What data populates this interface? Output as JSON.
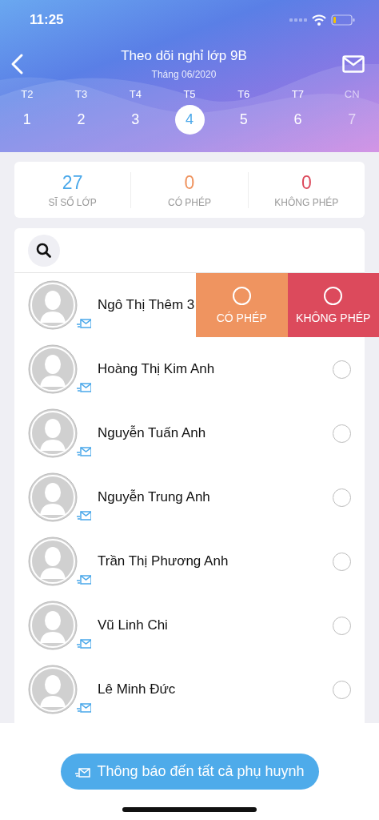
{
  "status_bar": {
    "time": "11:25"
  },
  "header": {
    "title": "Theo dõi nghỉ lớp 9B",
    "subtitle": "Tháng 06/2020"
  },
  "days": [
    {
      "weekday": "T2",
      "date": "1",
      "selected": false,
      "disabled": false
    },
    {
      "weekday": "T3",
      "date": "2",
      "selected": false,
      "disabled": false
    },
    {
      "weekday": "T4",
      "date": "3",
      "selected": false,
      "disabled": false
    },
    {
      "weekday": "T5",
      "date": "4",
      "selected": true,
      "disabled": false
    },
    {
      "weekday": "T6",
      "date": "5",
      "selected": false,
      "disabled": false
    },
    {
      "weekday": "T7",
      "date": "6",
      "selected": false,
      "disabled": false
    },
    {
      "weekday": "CN",
      "date": "7",
      "selected": false,
      "disabled": true
    }
  ],
  "stats": [
    {
      "value": "27",
      "label": "SĨ SỐ LỚP",
      "color": "#4aa8ea"
    },
    {
      "value": "0",
      "label": "CÓ PHÉP",
      "color": "#ef9460"
    },
    {
      "value": "0",
      "label": "KHÔNG PHÉP",
      "color": "#dc4a5c"
    }
  ],
  "students": [
    {
      "name": "Ngô Thị Thêm 3",
      "swiped": true,
      "actions": [
        {
          "kind": "excused",
          "label": "CÓ PHÉP"
        },
        {
          "kind": "unexcused",
          "label": "KHÔNG PHÉP"
        }
      ]
    },
    {
      "name": "Hoàng Thị Kim Anh",
      "swiped": false,
      "checked": false
    },
    {
      "name": "Nguyễn Tuấn Anh",
      "swiped": false,
      "checked": false
    },
    {
      "name": "Nguyễn Trung Anh",
      "swiped": false,
      "checked": false
    },
    {
      "name": "Trần Thị Phương Anh",
      "swiped": false,
      "checked": false
    },
    {
      "name": "Vũ Linh Chi",
      "swiped": false,
      "checked": false
    },
    {
      "name": "Lê Minh Đức",
      "swiped": false,
      "checked": false
    }
  ],
  "notify_button": {
    "label": "Thông báo đến tất cả phụ huynh"
  }
}
